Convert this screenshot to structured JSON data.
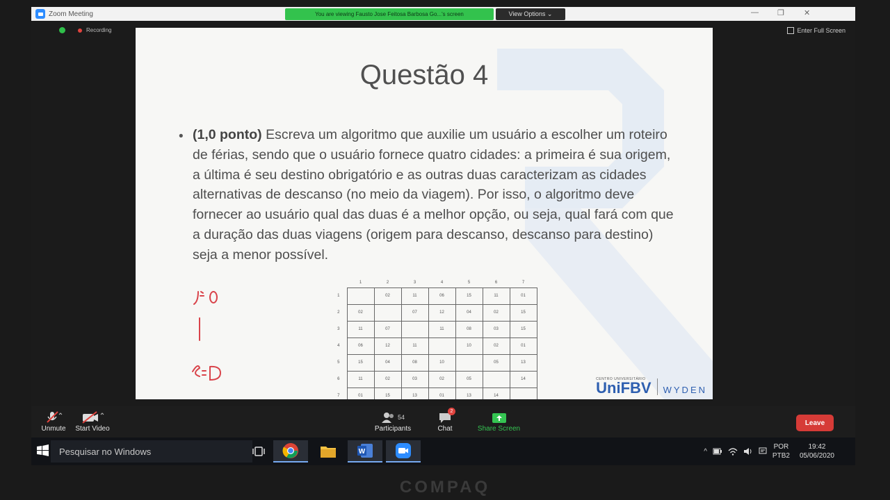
{
  "window": {
    "title": "Zoom Meeting",
    "viewing_banner": "You are viewing Fausto Jose Feitosa Barbosa Go...'s screen",
    "view_options": "View Options ⌄",
    "minimize": "—",
    "restore": "❐",
    "close": "✕"
  },
  "status": {
    "recording": "Recording",
    "fullscreen": "Enter Full Screen"
  },
  "slide": {
    "title": "Questão 4",
    "bullet": "•",
    "points": "(1,0 ponto)",
    "text": " Escreva um algoritmo que auxilie um usuário a escolher um roteiro de férias, sendo que o usuário fornece quatro cidades: a primeira é sua origem, a última é seu destino obrigatório e as outras duas caracterizam as cidades alternativas de descanso (no meio da viagem). Por isso, o algoritmo deve fornecer ao usuário qual das duas é a melhor opção, ou seja, qual fará com que a duração das duas viagens (origem para descanso, descanso para destino) seja a menor possível.",
    "annotation_color": "#d9434a",
    "grid": {
      "columns": [
        "1",
        "2",
        "3",
        "4",
        "5",
        "6",
        "7"
      ],
      "rows": [
        {
          "label": "1",
          "cells": [
            "",
            "02",
            "11",
            "06",
            "15",
            "11",
            "01"
          ]
        },
        {
          "label": "2",
          "cells": [
            "02",
            "",
            "07",
            "12",
            "04",
            "02",
            "15"
          ]
        },
        {
          "label": "3",
          "cells": [
            "11",
            "07",
            "",
            "11",
            "08",
            "03",
            "15"
          ]
        },
        {
          "label": "4",
          "cells": [
            "06",
            "12",
            "11",
            "",
            "10",
            "02",
            "01"
          ]
        },
        {
          "label": "5",
          "cells": [
            "15",
            "04",
            "08",
            "10",
            "",
            "05",
            "13"
          ]
        },
        {
          "label": "6",
          "cells": [
            "11",
            "02",
            "03",
            "02",
            "05",
            "",
            "14"
          ]
        },
        {
          "label": "7",
          "cells": [
            "01",
            "15",
            "13",
            "01",
            "13",
            "14",
            ""
          ]
        }
      ]
    },
    "logo": {
      "small": "CENTRO UNIVERSITÁRIO",
      "main": "UniFBV",
      "partner": "WYDEN"
    }
  },
  "controls": {
    "unmute": "Unmute",
    "start_video": "Start Video",
    "participants_count": "54",
    "participants": "Participants",
    "chat": "Chat",
    "chat_badge": "2",
    "share_screen": "Share Screen",
    "leave": "Leave"
  },
  "taskbar": {
    "search_placeholder": "Pesquisar no Windows",
    "lang_top": "POR",
    "lang_bottom": "PTB2",
    "time": "19:42",
    "date": "05/06/2020"
  },
  "device": {
    "brand": "COMPAQ"
  }
}
